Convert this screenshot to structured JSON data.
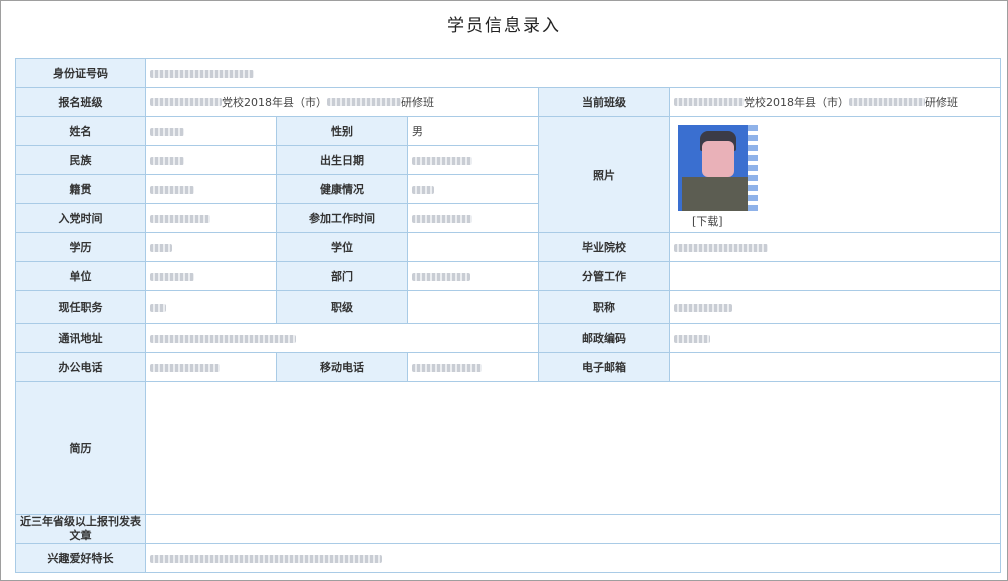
{
  "page": {
    "title": "学员信息录入"
  },
  "labels": {
    "id_number": "身份证号码",
    "enroll_class": "报名班级",
    "current_class": "当前班级",
    "name": "姓名",
    "gender": "性别",
    "photo": "照片",
    "ethnicity": "民族",
    "birth_date": "出生日期",
    "native_place": "籍贯",
    "health": "健康情况",
    "party_join_date": "入党时间",
    "work_start_date": "参加工作时间",
    "education": "学历",
    "degree": "学位",
    "graduate_school": "毕业院校",
    "employer": "单位",
    "department": "部门",
    "responsibility": "分管工作",
    "position": "现任职务",
    "rank": "职级",
    "title": "职称",
    "address": "通讯地址",
    "postal_code": "邮政编码",
    "office_phone": "办公电话",
    "mobile_phone": "移动电话",
    "email": "电子邮箱",
    "resume": "简历",
    "publications": "近三年省级以上报刊发表文章",
    "hobbies": "兴趣爱好特长"
  },
  "values": {
    "enroll_class_text": "党校2018年县（市）",
    "enroll_class_suffix": "研修班",
    "current_class_text": "党校2018年县（市）",
    "current_class_suffix": "研修班",
    "gender": "男",
    "download_link": "[下载]"
  },
  "colors": {
    "label_bg": "#e3f0fb",
    "border": "#a9cbe6"
  }
}
